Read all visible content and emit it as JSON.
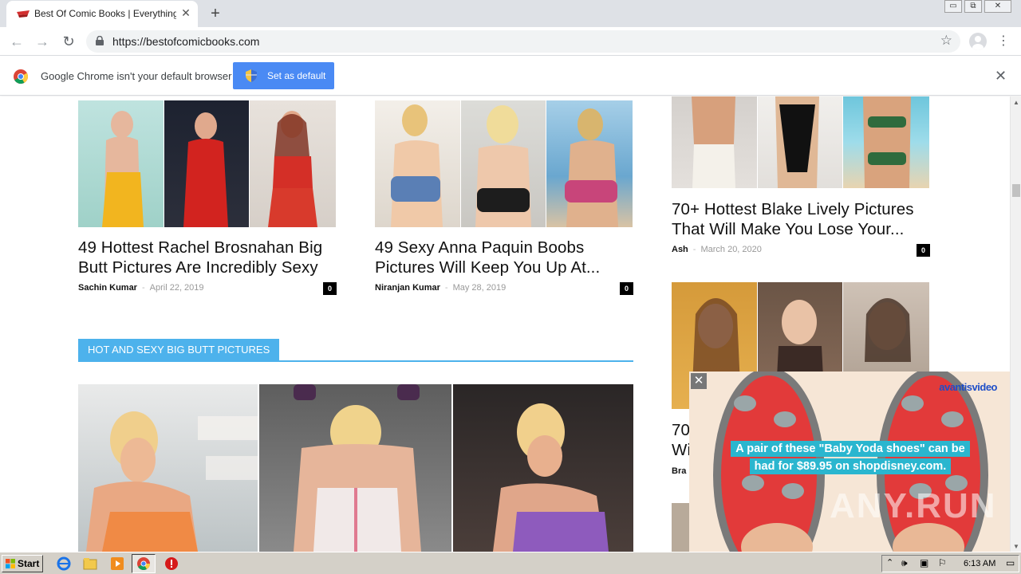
{
  "browser": {
    "tab_title": "Best Of Comic Books | Everything Ab",
    "tab_close": "✕",
    "new_tab": "+",
    "url": "https://bestofcomicbooks.com",
    "window_controls": [
      "▭",
      "⧉",
      "✕"
    ]
  },
  "infobar": {
    "message": "Google Chrome isn't your default browser",
    "button_label": "Set as default",
    "close": "✕"
  },
  "articles": [
    {
      "title": "49 Hottest Rachel Brosnahan Big Butt Pictures Are Incredibly Sexy",
      "author": "Sachin Kumar",
      "sep": "-",
      "date": "April 22, 2019",
      "comments": "0"
    },
    {
      "title": "49 Sexy Anna Paquin Boobs Pictures Will Keep You Up At...",
      "author": "Niranjan Kumar",
      "sep": "-",
      "date": "May 28, 2019",
      "comments": "0"
    },
    {
      "title": "70+ Hottest Blake Lively Pictures That Will Make You Lose Your...",
      "author": "Ash",
      "sep": "-",
      "date": "March 20, 2020",
      "comments": "0"
    },
    {
      "title_partial_1": "70",
      "title_partial_2": "Wi",
      "author_partial": "Bra"
    }
  ],
  "section": {
    "heading": "HOT AND SEXY BIG BUTT PICTURES"
  },
  "ad": {
    "close": "✕",
    "brand": "avantisvideo",
    "caption_line1": "A pair of these \"Baby Yoda shoes\" can be",
    "caption_line2": "had for $89.95 on shopdisney.com."
  },
  "watermark": "ANY.RUN",
  "taskbar": {
    "start": "Start",
    "clock": "6:13 AM"
  },
  "colors": {
    "accent": "#4db2ec",
    "chrome_button": "#4a8af4",
    "ad_caption": "#2ab6cf"
  }
}
